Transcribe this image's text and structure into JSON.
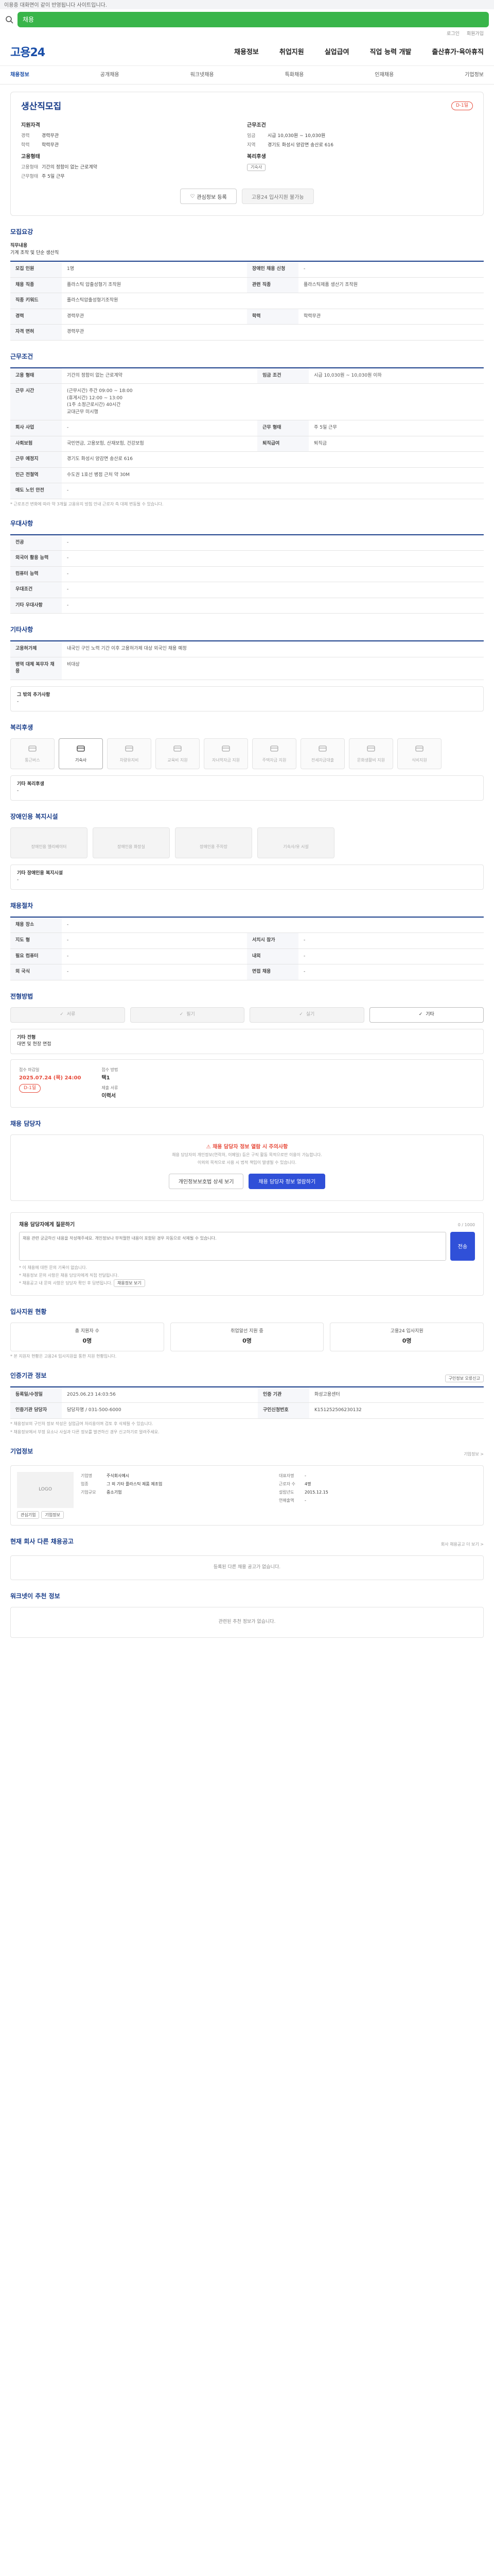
{
  "topnote": "이용중 대화면이 같이 반영됩니다 사이트입니다.",
  "search": {
    "value": "채용"
  },
  "util": [
    "로그인",
    "회원가입"
  ],
  "logo": "고용24",
  "mainnav": [
    "채용정보",
    "취업지원",
    "실업급여",
    "직업 능력 개발",
    "출산휴가·육아휴직"
  ],
  "subnav": [
    "채용정보",
    "공개채용",
    "워크넷채용",
    "특화채용",
    "인재채용",
    "기업정보"
  ],
  "job": {
    "title": "생산직모집",
    "badge": "D-1일",
    "left_title": "지원자격",
    "left": [
      {
        "k": "경력",
        "v": "경력무관"
      },
      {
        "k": "학력",
        "v": "학력무관"
      }
    ],
    "emp_title": "고용형태",
    "emp": [
      {
        "k": "고용형태",
        "v": "기간의 정함이 없는 근로계약"
      },
      {
        "k": "근무형태",
        "v": "주 5일 근무"
      }
    ],
    "right_title": "근무조건",
    "right": [
      {
        "k": "임금",
        "v": "시급 10,030원 ~ 10,030원"
      },
      {
        "k": "지역",
        "v": "경기도 화성시 양감면 송산로 616"
      }
    ],
    "welfare_title": "복리후생",
    "welfare_tag": "기숙사",
    "btn_interest": "관심정보 등록",
    "btn_apply": "고용24 입사지원 불가능"
  },
  "recruit": {
    "title": "모집요강",
    "desc_label": "직무내용",
    "desc_value": "기계 조작 및 단순 생산직",
    "rows": [
      [
        "모집 인원",
        "1명",
        "장애인 채용 신청",
        "-"
      ],
      [
        "채용 직종",
        "플라스틱 압출성형기 조작원",
        "관련 직종",
        "플라스틱제품 생산기 조작원"
      ],
      [
        "직종 키워드",
        "플라스틱압출성형기조작원",
        "",
        ""
      ],
      [
        "경력",
        "경력무관",
        "학력",
        "학력무관"
      ],
      [
        "자격 면허",
        "경력무관",
        "",
        ""
      ]
    ]
  },
  "condition": {
    "title": "근무조건",
    "rows": [
      [
        "고용 형태",
        "기간의 정함이 없는 근로계약",
        "임금 조건",
        "시급 10,030원 ~ 10,030원 이하"
      ],
      [
        "근무 시간",
        "(근무시간) 주간 09:00 ~ 18:00\n(휴게시간) 12:00 ~ 13:00\n(1주 소정근로시간) 40시간\n교대근무 미시행",
        "",
        ""
      ],
      [
        "회사 사업",
        "-",
        "근무 형태",
        "주 5일 근무"
      ],
      [
        "사회보험",
        "국민연금, 고용보험, 산재보험, 건강보험",
        "퇴직급여",
        "퇴직금"
      ],
      [
        "근무 예정지",
        "경기도 화성시 양감면 송산로 616",
        "",
        ""
      ],
      [
        "인근 전철역",
        "수도권 1호선 병점 근처 약 30M",
        "",
        ""
      ],
      [
        "매도 노인 안전",
        "-",
        "",
        ""
      ]
    ],
    "note": "* 근로조건 변화에 따라 약 3개월 고용유지 방침 안내 근로자 측 대체 변동될 수 있습니다."
  },
  "hire": {
    "title": "우대사항",
    "rows": [
      [
        "전공",
        "-"
      ],
      [
        "외국어 활용 능력",
        "-"
      ],
      [
        "컴퓨터 능력",
        "-"
      ],
      [
        "우대조건",
        "-"
      ],
      [
        "기타 우대사항",
        "-"
      ]
    ]
  },
  "etc": {
    "title": "기타사항",
    "rows": [
      [
        "고용허가제",
        "내국인 구인 노력 기간 이후 고용허가제 대상 외국인 채용 예정"
      ],
      [
        "병역 대체 복무자 채용",
        "비대상"
      ]
    ],
    "extra_label": "그 밖의 추가사항",
    "extra_value": "-"
  },
  "welfare": {
    "title": "복리후생",
    "items": [
      {
        "label": "통근버스",
        "on": false
      },
      {
        "label": "기숙사",
        "on": true
      },
      {
        "label": "차량유지비",
        "on": false
      },
      {
        "label": "교육비 지원",
        "on": false
      },
      {
        "label": "자녀학자금 지원",
        "on": false
      },
      {
        "label": "주택자금 지원",
        "on": false
      },
      {
        "label": "전세자금대출",
        "on": false
      },
      {
        "label": "문화생활비 지원",
        "on": false
      },
      {
        "label": "식비지원",
        "on": false
      }
    ],
    "box_label": "기타 복리후생",
    "box_value": "-"
  },
  "disabled": {
    "title": "장애인용 복지시설",
    "items": [
      "장애인용 엘리베이터",
      "장애인용 화장실",
      "장애인용 주차장",
      "기숙사/유 시설"
    ],
    "box_label": "기타 장애인용 복지시설",
    "box_value": "-"
  },
  "process": {
    "title": "채용절차",
    "rows": [
      [
        "채용 장소",
        "-",
        "",
        ""
      ],
      [
        "지도 형",
        "-",
        "서치시 참가",
        "-"
      ],
      [
        "필요 컴퓨터",
        "-",
        "내외",
        "-"
      ],
      [
        "외 국식",
        "-",
        "면접 채용",
        "-"
      ]
    ]
  },
  "method": {
    "title": "전형방법",
    "steps": [
      "서류",
      "필기",
      "실기",
      "기타"
    ],
    "active": 3,
    "etc_label": "기타 전형",
    "etc_value": "대면 및 현장 면접"
  },
  "period": {
    "deadline_label": "접수 마감일",
    "deadline_value": "2025.07.24 (목) 24:00",
    "deadline_badge": "D-1일",
    "apply_label": "접수 방법",
    "apply_value": "택1",
    "doc_label": "제출 서류",
    "doc_value": "이력서"
  },
  "manager": {
    "title": "채용 담당자",
    "warn": "채용 담당자 정보 열람 시 주의사항",
    "msg1": "채용 담당자의 개인정보(연락처, 이메일) 등은 구직 활동 목적으로만 이용이 가능합니다.",
    "msg2": "이외의 목적으로 사용 시 법적 책임이 발생될 수 있습니다.",
    "btn1": "개인정보보호법 상세 보기",
    "btn2": "채용 담당자 정보 열람하기"
  },
  "qna": {
    "title": "채용 담당자에게 질문하기",
    "count": "0 / 1000",
    "placeholder": "채용 관련 궁금하신 내용을 작성해주세요. 개인정보나 부적절한 내용이 포함된 경우 자동으로 삭제될 수 있습니다.",
    "send": "전송",
    "notes": [
      "* 이 채용에 대한 문의 기록이 없습니다.",
      "* 채용정보 문의 사항은 채용 담당자에게 직접 전달됩니다.",
      "* 채용공고 내 문의 사항은 담당자 확인 후 답변됩니다."
    ],
    "view_btn": "채용정보 보기"
  },
  "stats": {
    "title": "입사지원 현황",
    "items": [
      {
        "label": "총 지원자 수",
        "value": "0명"
      },
      {
        "label": "취업알선 지원 중",
        "value": "0명"
      },
      {
        "label": "고용24 입사지원",
        "value": "0명"
      }
    ],
    "note": "* 본 지원자 현황은 고용24 입사지원을 통한 지원 현황입니다."
  },
  "info": {
    "title": "인증기관 정보",
    "print": "구인정보 오류신고",
    "rows": [
      [
        "등록일/수정일",
        "2025.06.23 14:03:56",
        "인증 기관",
        "화성고용센터"
      ],
      [
        "인증기관 담당자",
        "담당자명 / 031-500-6000",
        "구인신청번호",
        "K151252506230132"
      ]
    ],
    "notes": [
      "* 채용정보의 구인처 정보 작성은 실업급여 처리용이며 검토 후 삭제될 수 있습니다.",
      "* 채용정보에서 부정 요소나 사실과 다른 정보를 발견하신 경우 신고하기로 알려주세요."
    ]
  },
  "company": {
    "title": "기업정보",
    "link": "기업정보 >",
    "logo": "LOGO",
    "btn_interest": "관심기업",
    "btn_more": "기업정보",
    "col1": [
      {
        "k": "기업명",
        "v": "주식회사예시"
      },
      {
        "k": "업종",
        "v": "그 외 기타 플라스틱 제품 제조업"
      },
      {
        "k": "기업규모",
        "v": "중소기업"
      }
    ],
    "col2": [
      {
        "k": "대표자명",
        "v": "-"
      },
      {
        "k": "근로자 수",
        "v": "4명"
      },
      {
        "k": "설립년도",
        "v": "2015.12.15"
      },
      {
        "k": "연매출액",
        "v": "-"
      }
    ]
  },
  "similar": {
    "title": "현재 회사 다른 채용공고",
    "sub": "등록된 다른 채용 공고가 없습니다.",
    "empty": "등록된 다른 채용 공고가 없습니다.",
    "more": "회사 채용공고 더 보기 >"
  },
  "recommend": {
    "title": "워크넷이 추천 정보",
    "empty": "관련된 추천 정보가 없습니다."
  }
}
